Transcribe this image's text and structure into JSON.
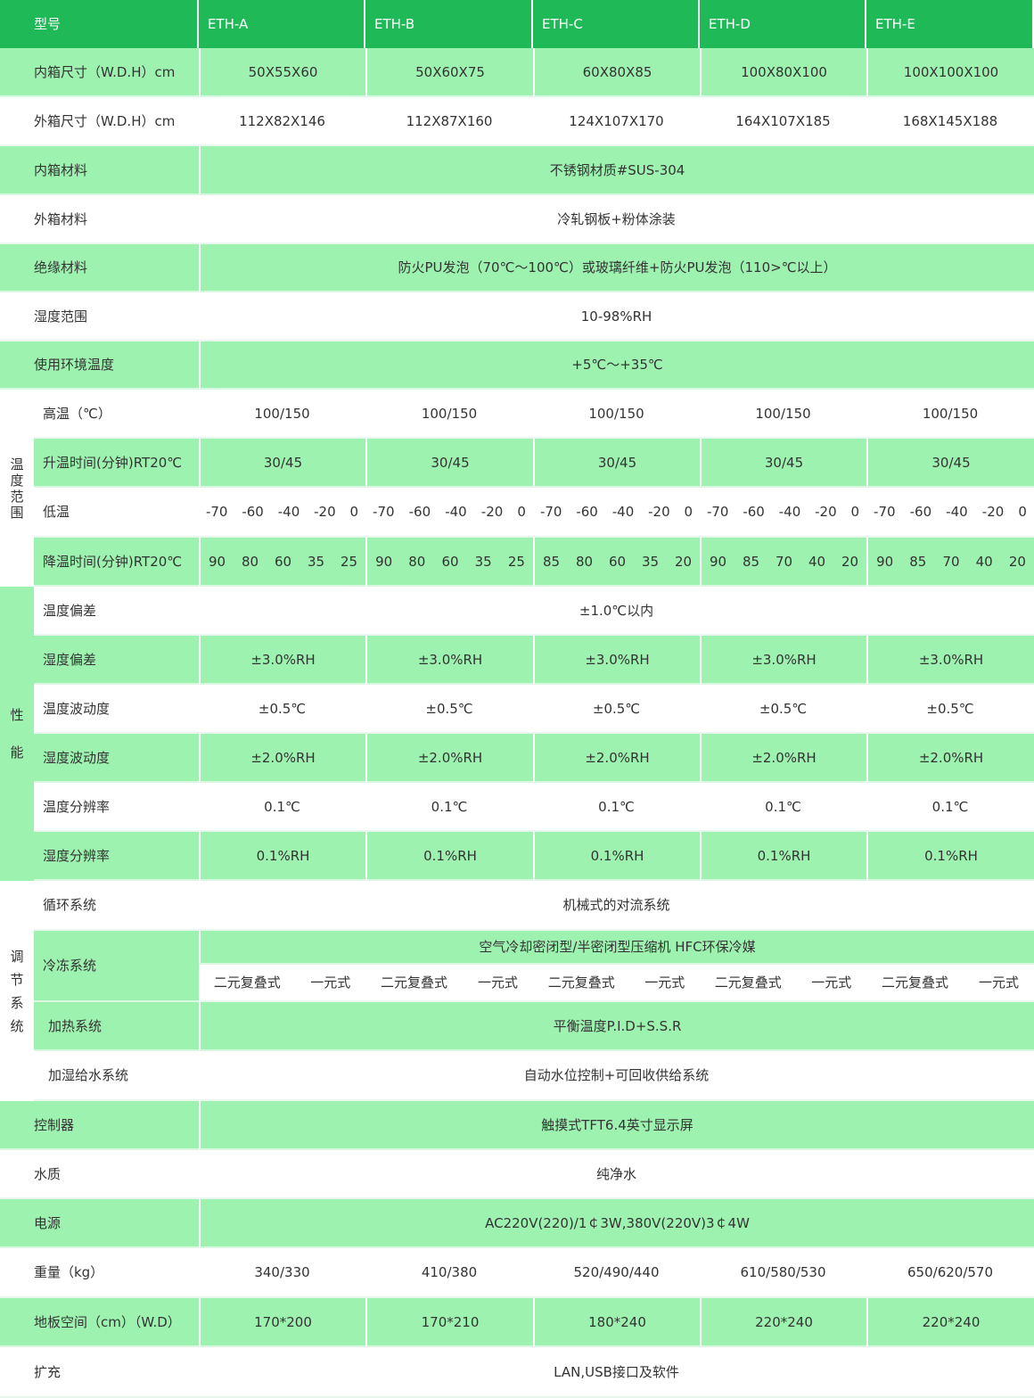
{
  "header": {
    "label": "型号",
    "models": [
      "ETH-A",
      "ETH-B",
      "ETH-C",
      "ETH-D",
      "ETH-E"
    ]
  },
  "inner_size": {
    "label": "内箱尺寸（W.D.H）cm",
    "values": [
      "50X55X60",
      "50X60X75",
      "60X80X85",
      "100X80X100",
      "100X100X100"
    ]
  },
  "outer_size": {
    "label": "外箱尺寸（W.D.H）cm",
    "values": [
      "112X82X146",
      "112X87X160",
      "124X107X170",
      "164X107X185",
      "168X145X188"
    ]
  },
  "inner_material": {
    "label": "内箱材料",
    "value": "不锈钢材质#SUS-304"
  },
  "outer_material": {
    "label": "外箱材料",
    "value": "冷轧钢板+粉体涂装"
  },
  "insulation": {
    "label": "绝缘材料",
    "value": "防火PU发泡（70℃～100℃）或玻璃纤维+防火PU发泡（110>℃以上）"
  },
  "humidity_range": {
    "label": "湿度范围",
    "value": "10-98%RH"
  },
  "ambient_temp": {
    "label": "使用环境温度",
    "value": "+5℃～+35℃"
  },
  "temp_range": {
    "group_label": [
      "温",
      "度",
      "范",
      "围"
    ],
    "high": {
      "label": "高温（℃）",
      "values": [
        "100/150",
        "100/150",
        "100/150",
        "100/150",
        "100/150"
      ]
    },
    "heat_time": {
      "label": "升温时间(分钟)RT20℃",
      "values": [
        "30/45",
        "30/45",
        "30/45",
        "30/45",
        "30/45"
      ]
    },
    "low": {
      "label": "低温",
      "values": [
        [
          "-70",
          "-60",
          "-40",
          "-20",
          "0"
        ],
        [
          "-70",
          "-60",
          "-40",
          "-20",
          "0"
        ],
        [
          "-70",
          "-60",
          "-40",
          "-20",
          "0"
        ],
        [
          "-70",
          "-60",
          "-40",
          "-20",
          "0"
        ],
        [
          "-70",
          "-60",
          "-40",
          "-20",
          "0"
        ]
      ]
    },
    "cool_time": {
      "label": "降温时间(分钟)RT20℃",
      "values": [
        [
          "90",
          "80",
          "60",
          "35",
          "25"
        ],
        [
          "90",
          "80",
          "60",
          "35",
          "25"
        ],
        [
          "85",
          "80",
          "60",
          "35",
          "20"
        ],
        [
          "90",
          "85",
          "70",
          "40",
          "20"
        ],
        [
          "90",
          "85",
          "70",
          "40",
          "20"
        ]
      ]
    }
  },
  "performance": {
    "group_label": [
      "性",
      "能"
    ],
    "temp_deviation": {
      "label": "温度偏差",
      "value": "±1.0℃以内"
    },
    "hum_deviation": {
      "label": "湿度偏差",
      "values": [
        "±3.0%RH",
        "±3.0%RH",
        "±3.0%RH",
        "±3.0%RH",
        "±3.0%RH"
      ]
    },
    "temp_fluct": {
      "label": "温度波动度",
      "values": [
        "±0.5℃",
        "±0.5℃",
        "±0.5℃",
        "±0.5℃",
        "±0.5℃"
      ]
    },
    "hum_fluct": {
      "label": "湿度波动度",
      "values": [
        "±2.0%RH",
        "±2.0%RH",
        "±2.0%RH",
        "±2.0%RH",
        "±2.0%RH"
      ]
    },
    "temp_res": {
      "label": "温度分辨率",
      "values": [
        "0.1℃",
        "0.1℃",
        "0.1℃",
        "0.1℃",
        "0.1℃"
      ]
    },
    "hum_res": {
      "label": "湿度分辨率",
      "values": [
        "0.1%RH",
        "0.1%RH",
        "0.1%RH",
        "0.1%RH",
        "0.1%RH"
      ]
    }
  },
  "regulation": {
    "group_label": [
      "调",
      "节",
      "系",
      "统"
    ],
    "circulation": {
      "label": "循环系统",
      "value": "机械式的对流系统"
    },
    "refrigeration": {
      "label": "冷冻系统",
      "value": "空气冷却密闭型/半密闭型压缩机 HFC环保冷媒",
      "options": [
        [
          "二元复叠式",
          "一元式"
        ],
        [
          "二元复叠式",
          "一元式"
        ],
        [
          "二元复叠式",
          "一元式"
        ],
        [
          "二元复叠式",
          "一元式"
        ],
        [
          "二元复叠式",
          "一元式"
        ]
      ]
    },
    "heating": {
      "label": "加热系统",
      "value": "平衡温度P.I.D+S.S.R"
    },
    "water_supply": {
      "label": "加湿给水系统",
      "value": "自动水位控制+可回收供给系统"
    }
  },
  "controller": {
    "label": "控制器",
    "value": "触摸式TFT6.4英寸显示屏"
  },
  "water": {
    "label": "水质",
    "value": "纯净水"
  },
  "power": {
    "label": "电源",
    "value": "AC220V(220)/1￠3W,380V(220V)3￠4W"
  },
  "weight": {
    "label": "重量（kg）",
    "values": [
      "340/330",
      "410/380",
      "520/490/440",
      "610/580/530",
      "650/620/570"
    ]
  },
  "floor_space": {
    "label": "地板空间（cm）（W.D）",
    "values": [
      "170*200",
      "170*210",
      "180*240",
      "220*240",
      "220*240"
    ]
  },
  "expansion": {
    "label": "扩充",
    "value": "LAN,USB接口及软件"
  }
}
